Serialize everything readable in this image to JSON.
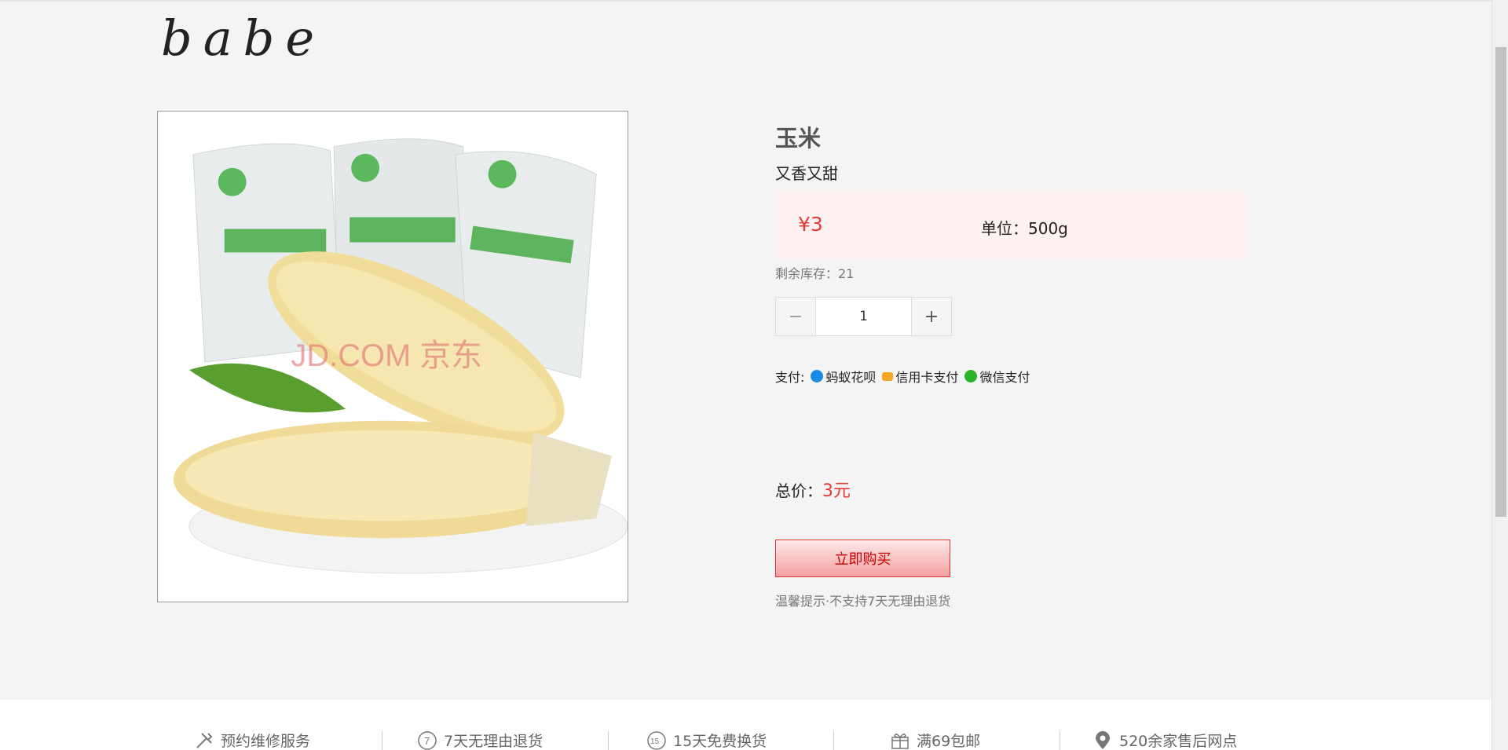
{
  "logo": "babe",
  "product": {
    "title": "玉米",
    "subtitle": "又香又甜",
    "price": "¥3",
    "unit": "单位：500g",
    "stock": "剩余库存：21",
    "quantity": "1",
    "image_icon": "corn-product-image"
  },
  "payment": {
    "label": "支付:",
    "methods": [
      {
        "icon": "ant-huabei-icon",
        "label": "蚂蚁花呗"
      },
      {
        "icon": "credit-card-icon",
        "label": "信用卡支付"
      },
      {
        "icon": "wechat-pay-icon",
        "label": "微信支付"
      }
    ]
  },
  "total": {
    "label": "总价：",
    "value": "3元"
  },
  "buy_button": "立即购买",
  "tip": "温馨提示·不支持7天无理由退货",
  "services": [
    {
      "icon": "repair-tools-icon",
      "label": "预约维修服务"
    },
    {
      "icon": "return-7-icon",
      "label": "7天无理由退货"
    },
    {
      "icon": "exchange-15-icon",
      "label": "15天免费换货"
    },
    {
      "icon": "gift-icon",
      "label": "满69包邮"
    },
    {
      "icon": "location-pin-icon",
      "label": "520余家售后网点"
    }
  ],
  "colors": {
    "price_red": "#e53935",
    "price_bg": "#fdf1f1",
    "page_bg": "#f4f4f4"
  }
}
